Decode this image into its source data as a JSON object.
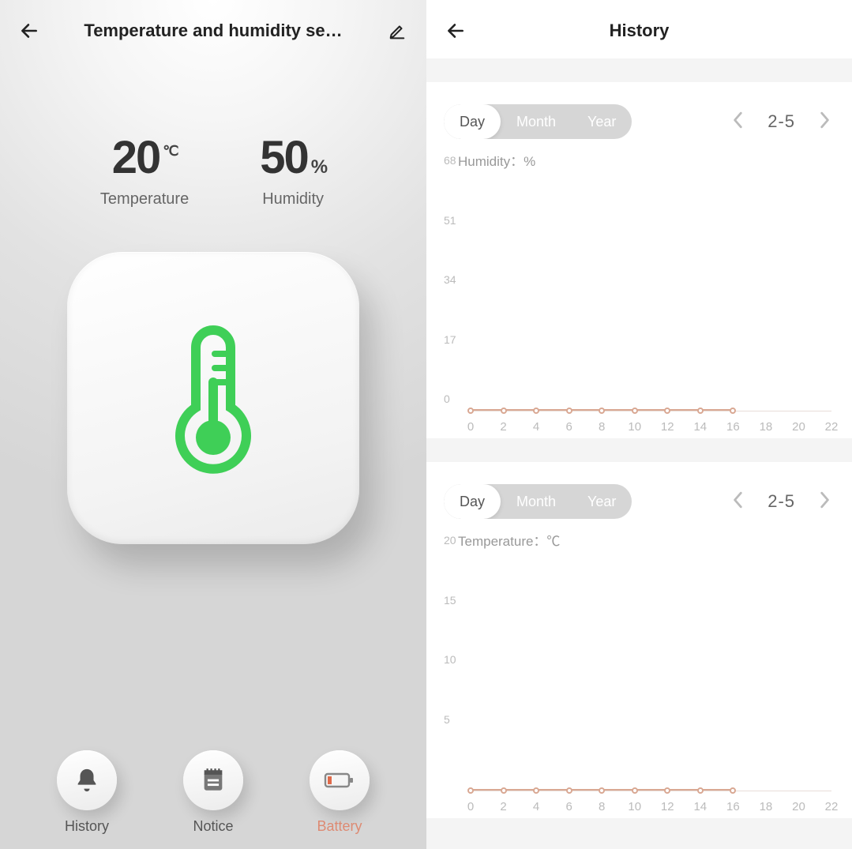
{
  "left": {
    "title": "Temperature and humidity se…",
    "temperature": {
      "value": "20",
      "unit": "℃",
      "label": "Temperature"
    },
    "humidity": {
      "value": "50",
      "unit": "%",
      "label": "Humidity"
    },
    "nav": {
      "history": "History",
      "notice": "Notice",
      "battery": "Battery"
    }
  },
  "right": {
    "title": "History",
    "segments": {
      "day": "Day",
      "month": "Month",
      "year": "Year"
    },
    "date": "2-5",
    "humidity_label": "Humidity：%",
    "temperature_label": "Temperature：℃"
  },
  "chart_data": [
    {
      "type": "line",
      "title": "Humidity：%",
      "xlabel": "",
      "ylabel": "",
      "ylim": [
        0,
        68
      ],
      "y_ticks": [
        68,
        51,
        34,
        17,
        0
      ],
      "x_ticks": [
        0,
        2,
        4,
        6,
        8,
        10,
        12,
        14,
        16,
        18,
        20,
        22
      ],
      "x": [
        0,
        2,
        4,
        6,
        8,
        10,
        12,
        14,
        16
      ],
      "values": [
        0,
        0,
        0,
        0,
        0,
        0,
        0,
        0,
        0
      ]
    },
    {
      "type": "line",
      "title": "Temperature：℃",
      "xlabel": "",
      "ylabel": "",
      "ylim": [
        0,
        20
      ],
      "y_ticks": [
        20,
        15,
        10,
        5
      ],
      "x_ticks": [
        0,
        2,
        4,
        6,
        8,
        10,
        12,
        14,
        16,
        18,
        20,
        22
      ],
      "x": [
        0,
        2,
        4,
        6,
        8,
        10,
        12,
        14,
        16
      ],
      "values": [
        0,
        0,
        0,
        0,
        0,
        0,
        0,
        0,
        0
      ]
    }
  ]
}
